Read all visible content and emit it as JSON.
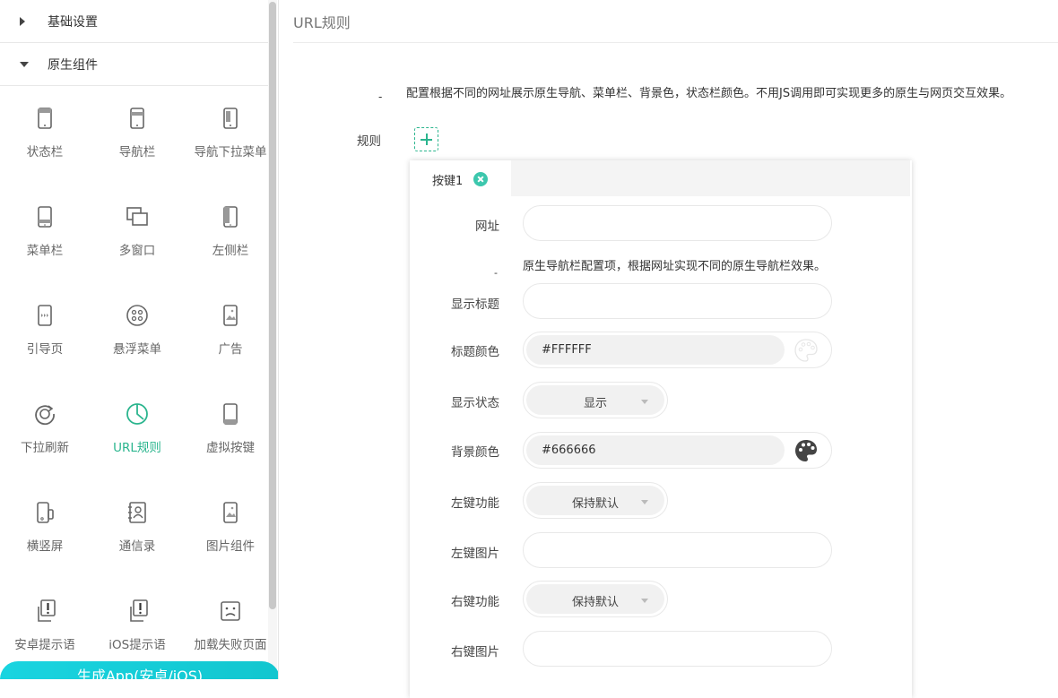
{
  "sidebar": {
    "sections": [
      {
        "label": "基础设置",
        "expanded": false
      },
      {
        "label": "原生组件",
        "expanded": true
      }
    ],
    "items": [
      {
        "label": "状态栏",
        "icon": "phone-statusbar-icon"
      },
      {
        "label": "导航栏",
        "icon": "phone-navbar-icon"
      },
      {
        "label": "导航下拉菜单",
        "icon": "phone-dropdown-icon"
      },
      {
        "label": "菜单栏",
        "icon": "phone-menubar-icon"
      },
      {
        "label": "多窗口",
        "icon": "multi-window-icon"
      },
      {
        "label": "左侧栏",
        "icon": "phone-leftbar-icon"
      },
      {
        "label": "引导页",
        "icon": "phone-guide-icon"
      },
      {
        "label": "悬浮菜单",
        "icon": "floating-menu-icon"
      },
      {
        "label": "广告",
        "icon": "phone-ad-icon"
      },
      {
        "label": "下拉刷新",
        "icon": "refresh-icon"
      },
      {
        "label": "URL规则",
        "icon": "url-rule-icon",
        "active": true
      },
      {
        "label": "虚拟按键",
        "icon": "virtual-key-icon"
      },
      {
        "label": "横竖屏",
        "icon": "rotate-screen-icon"
      },
      {
        "label": "通信录",
        "icon": "contacts-icon"
      },
      {
        "label": "图片组件",
        "icon": "image-component-icon"
      },
      {
        "label": "安卓提示语",
        "icon": "android-alert-icon"
      },
      {
        "label": "iOS提示语",
        "icon": "ios-alert-icon"
      },
      {
        "label": "加载失败页面",
        "icon": "load-fail-icon"
      }
    ],
    "generate_button": "生成App(安卓/iOS)"
  },
  "main": {
    "title": "URL规则",
    "desc_dash": "-",
    "description": "配置根据不同的网址展示原生导航、菜单栏、背景色，状态栏颜色。不用JS调用即可实现更多的原生与网页交互效果。",
    "rule_label": "规则",
    "panel": {
      "tab_label": "按键1",
      "fields": {
        "url_label": "网址",
        "url_value": "",
        "note_dash": "-",
        "note": "原生导航栏配置项，根据网址实现不同的原生导航栏效果。",
        "show_title_label": "显示标题",
        "show_title_value": "",
        "title_color_label": "标题颜色",
        "title_color_value": "#FFFFFF",
        "show_status_label": "显示状态",
        "show_status_value": "显示",
        "bg_color_label": "背景颜色",
        "bg_color_value": "#666666",
        "left_func_label": "左键功能",
        "left_func_value": "保持默认",
        "left_img_label": "左键图片",
        "left_img_value": "",
        "right_func_label": "右键功能",
        "right_func_value": "保持默认",
        "right_img_label": "右键图片",
        "right_img_value": ""
      }
    }
  },
  "colors": {
    "accent": "#2bb58e",
    "generate_gradient_start": "#19d4e0",
    "generate_gradient_end": "#12c6cf",
    "tab_close": "#3cc7ad"
  }
}
